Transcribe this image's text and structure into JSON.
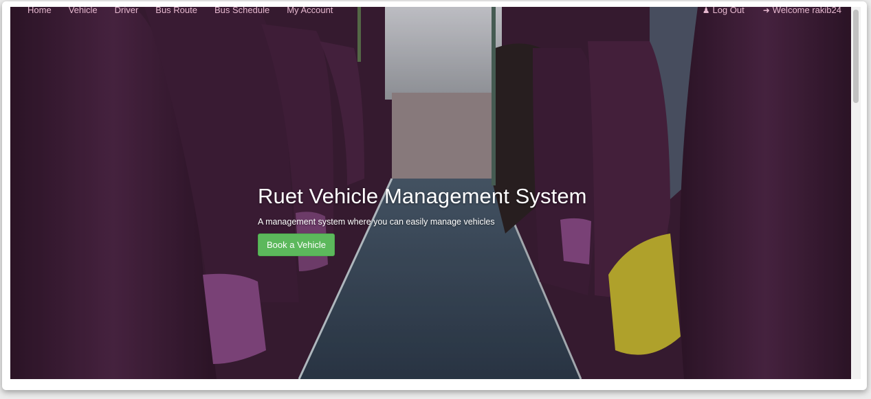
{
  "nav": {
    "left": [
      {
        "label": "Home"
      },
      {
        "label": "Vehicle"
      },
      {
        "label": "Driver"
      },
      {
        "label": "Bus Route"
      },
      {
        "label": "Bus Schedule"
      },
      {
        "label": "My Account"
      }
    ],
    "logout": {
      "label": "Log Out",
      "icon": "user-icon"
    },
    "welcome": {
      "label": "Welcome rakib24",
      "icon": "login-icon"
    }
  },
  "hero": {
    "title": "Ruet Vehicle Management System",
    "subtitle": "A management system where you can easily manage vehicles",
    "button": "Book a Vehicle"
  },
  "colors": {
    "accent_button": "#5cb85c",
    "nav_link": "#e6b8cf",
    "seat": "#4a2440"
  }
}
